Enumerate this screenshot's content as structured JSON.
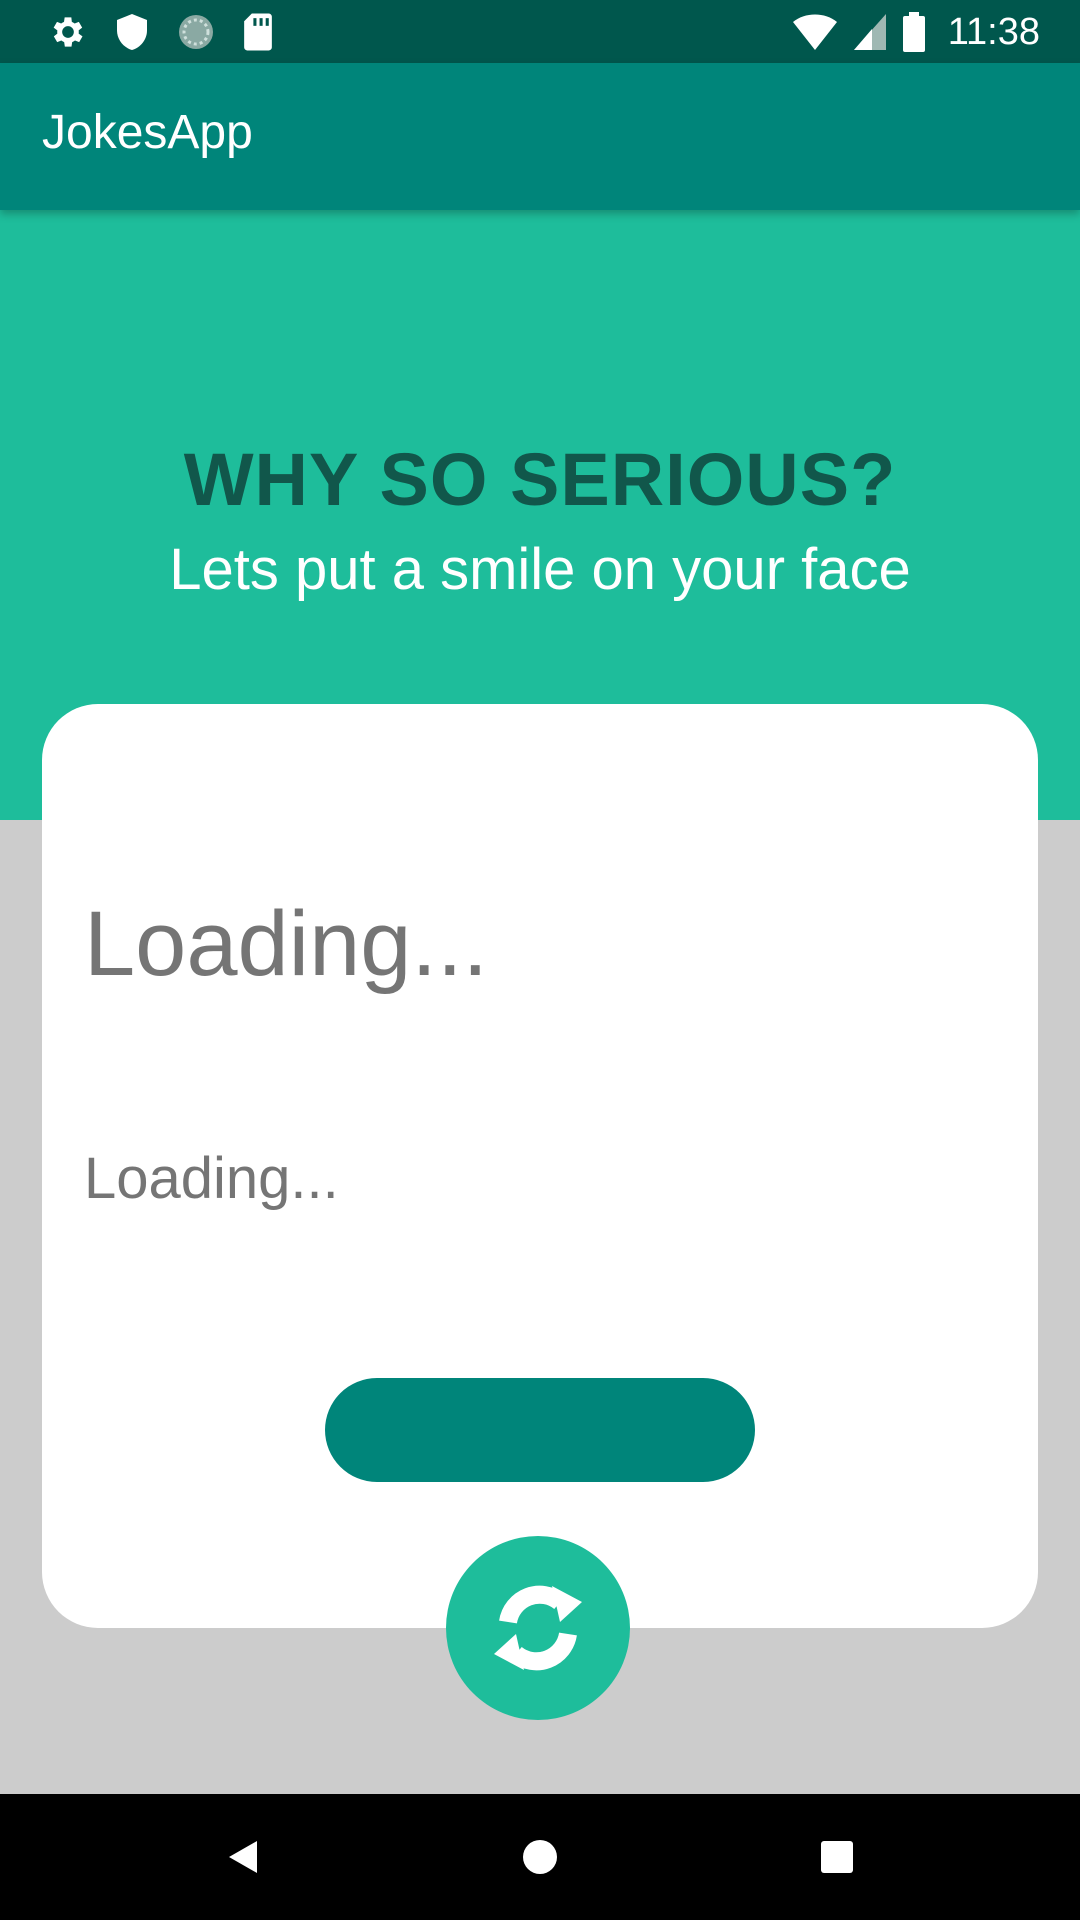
{
  "status_bar": {
    "time": "11:38",
    "left_icons": [
      "settings-icon",
      "shield-icon",
      "sync-progress-icon",
      "sd-card-icon"
    ],
    "right_icons": [
      "wifi-icon",
      "cell-signal-icon",
      "battery-icon"
    ]
  },
  "app_bar": {
    "title": "JokesApp"
  },
  "hero": {
    "heading": "WHY SO SERIOUS?",
    "subheading": "Lets put a smile on your face"
  },
  "joke_card": {
    "setup": "Loading...",
    "punchline": "Loading...",
    "button_label": ""
  },
  "fab": {
    "icon": "refresh-icon"
  },
  "nav_bar": {
    "buttons": [
      "back-icon",
      "home-icon",
      "recents-icon"
    ]
  },
  "colors": {
    "status_bar": "#00574d",
    "app_bar": "#00857a",
    "accent": "#1ebd9b",
    "heading_dark": "#11574b",
    "background": "#cccccc",
    "card": "#ffffff",
    "text_grey": "#757575"
  }
}
